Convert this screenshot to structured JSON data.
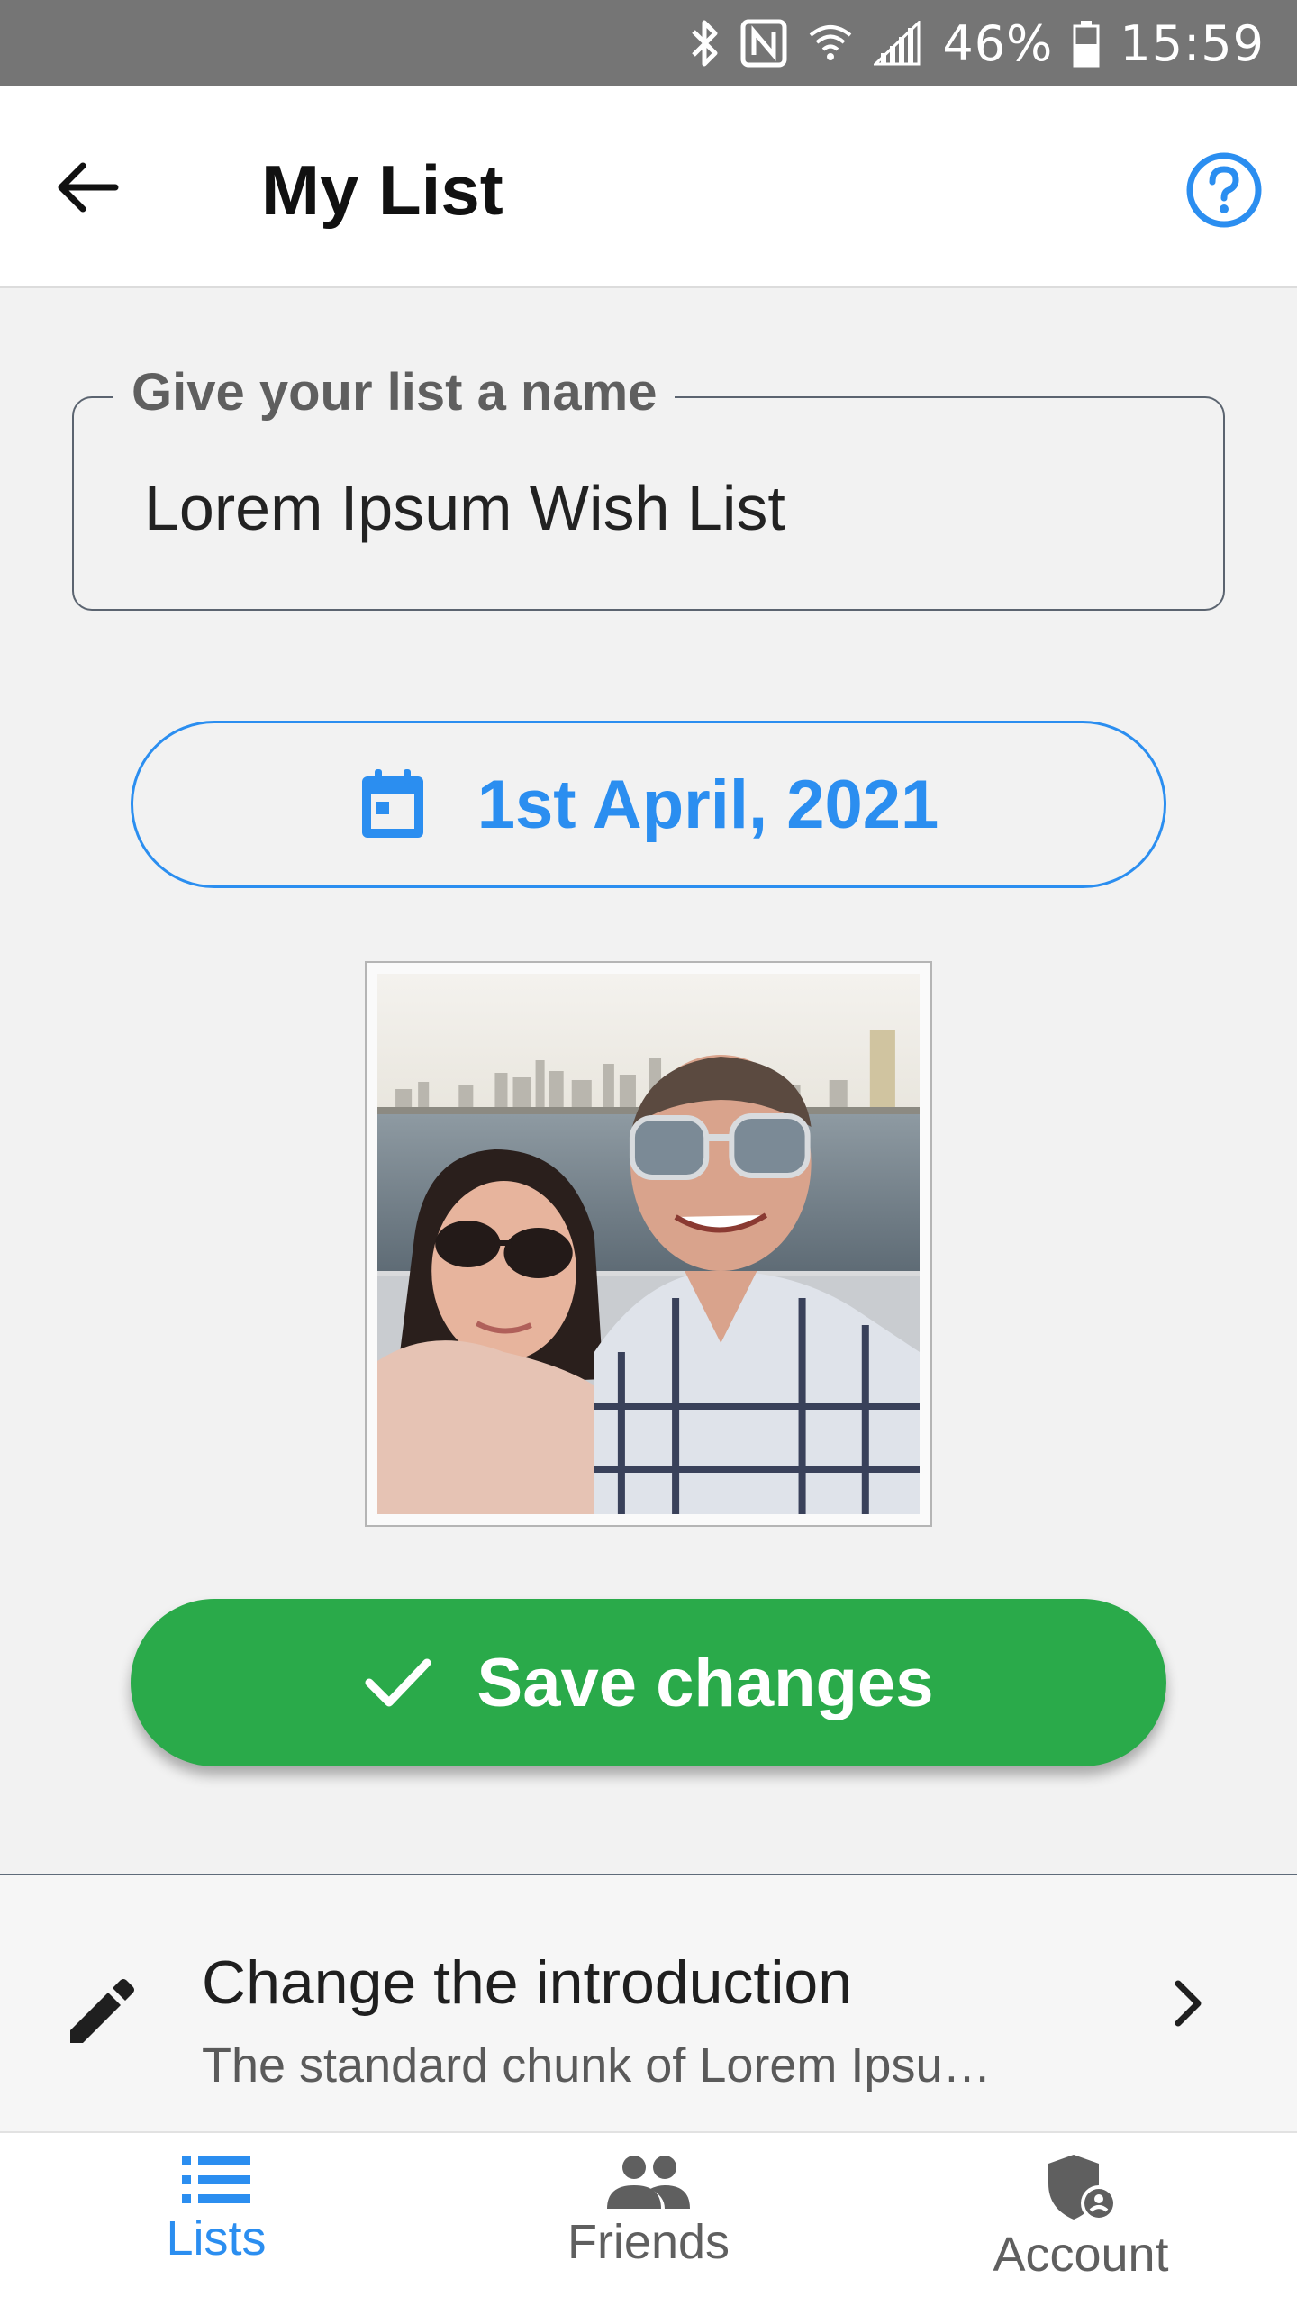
{
  "status_bar": {
    "battery_percent": "46%",
    "time": "15:59",
    "icons": [
      "bluetooth-icon",
      "nfc-icon",
      "wifi-icon",
      "signal-icon",
      "battery-icon"
    ]
  },
  "app_bar": {
    "title": "My List",
    "back_icon": "arrow-back-icon",
    "help_icon": "help-circle-icon"
  },
  "name_field": {
    "label": "Give your list a name",
    "value": "Lorem Ipsum Wish List"
  },
  "date_button": {
    "label": "1st April, 2021",
    "icon": "calendar-icon"
  },
  "photo": {
    "alt": "Couple selfie with city skyline"
  },
  "save_button": {
    "label": "Save changes",
    "icon": "check-icon"
  },
  "intro_row": {
    "title": "Change the introduction",
    "subtitle": "The standard chunk of Lorem Ipsu…",
    "icon": "pencil-icon",
    "chevron": "chevron-right-icon"
  },
  "bottom_nav": {
    "items": [
      {
        "label": "Lists",
        "icon": "list-icon",
        "active": true
      },
      {
        "label": "Friends",
        "icon": "people-icon",
        "active": false
      },
      {
        "label": "Account",
        "icon": "shield-account-icon",
        "active": false
      }
    ]
  },
  "colors": {
    "accent_blue": "#2b8ef0",
    "save_green": "#2aaa4a",
    "status_bar": "#757575",
    "background": "#f2f2f2"
  }
}
